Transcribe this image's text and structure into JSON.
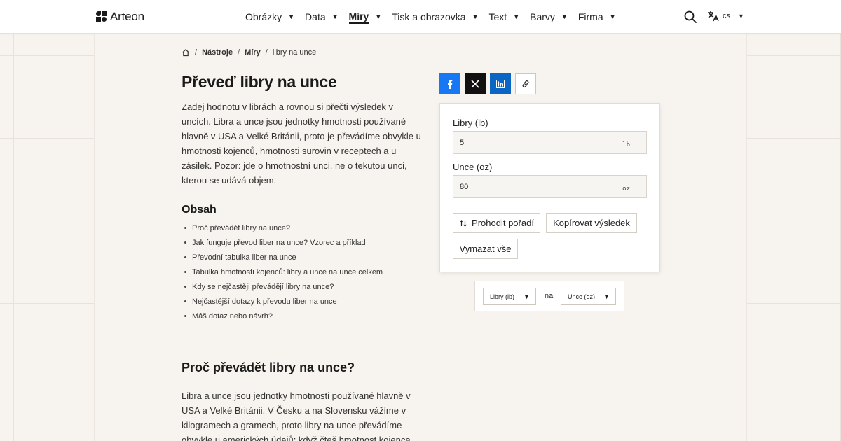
{
  "header": {
    "logo_text": "Arteon",
    "nav": [
      {
        "label": "Obrázky",
        "active": false
      },
      {
        "label": "Data",
        "active": false
      },
      {
        "label": "Míry",
        "active": true
      },
      {
        "label": "Tisk a obrazovka",
        "active": false
      },
      {
        "label": "Text",
        "active": false
      },
      {
        "label": "Barvy",
        "active": false
      },
      {
        "label": "Firma",
        "active": false
      }
    ],
    "language": "cs"
  },
  "breadcrumb": {
    "items": [
      "Nástroje",
      "Míry",
      "libry na unce"
    ]
  },
  "page": {
    "title": "Převeď libry na unce",
    "intro": "Zadej hodnotu v librách a rovnou si přečti výsledek v uncích. Libra a unce jsou jednotky hmotnosti používané hlavně v USA a Velké Británii, proto je převádíme obvykle u hmotnosti kojenců, hmotnosti surovin v receptech a u zásilek. Pozor: jde o hmotnostní unci, ne o tekutou unci, kterou se udává objem."
  },
  "toc": {
    "title": "Obsah",
    "items": [
      "Proč převádět libry na unce?",
      "Jak funguje převod liber na unce? Vzorec a příklad",
      "Převodní tabulka liber na unce",
      "Tabulka hmotnosti kojenců: libry a unce na unce celkem",
      "Kdy se nejčastěji převádějí libry na unce?",
      "Nejčastější dotazy k převodu liber na unce",
      "Máš dotaz nebo návrh?"
    ]
  },
  "section": {
    "title": "Proč převádět libry na unce?",
    "body": "Libra a unce jsou jednotky hmotnosti používané hlavně v USA a Velké Británii. V Česku a na Slovensku vážíme v kilogramech a gramech, proto libry na unce převádíme obvykle u amerických údajů: když čteš hmotnost kojence"
  },
  "converter": {
    "from_label": "Libry (lb)",
    "from_value": "5",
    "from_unit": "lb",
    "to_label": "Unce (oz)",
    "to_value": "80",
    "to_unit": "oz",
    "swap_label": "Prohodit pořadí",
    "copy_label": "Kopírovat výsledek",
    "clear_label": "Vymazat vše"
  },
  "unit_select": {
    "from": "Libry (lb)",
    "connector": "na",
    "to": "Unce (oz)"
  },
  "colors": {
    "facebook": "#1877f2",
    "x": "#111111",
    "linkedin": "#0a66c2",
    "background": "#f7f3ee"
  }
}
